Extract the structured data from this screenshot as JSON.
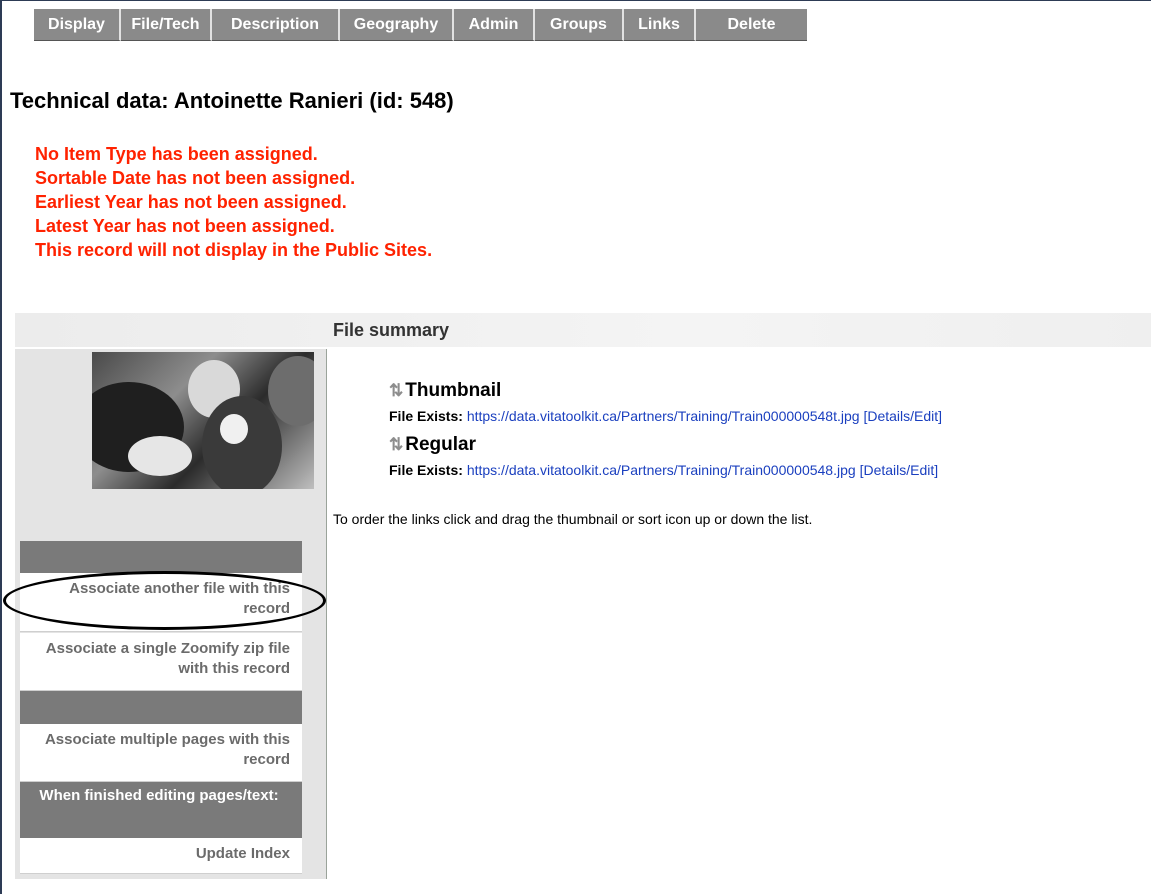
{
  "tabs": [
    "Display",
    "File/Tech",
    "Description",
    "Geography",
    "Admin",
    "Groups",
    "Links",
    "Delete"
  ],
  "page_title": "Technical data: Antoinette Ranieri (id: 548)",
  "warnings": [
    "No Item Type has been assigned.",
    "Sortable Date has not been assigned.",
    "Earliest Year has not been assigned.",
    "Latest Year has not been assigned.",
    "This record will not display in the Public Sites."
  ],
  "file_summary": {
    "title": "File summary",
    "files": [
      {
        "name": "Thumbnail",
        "label": "File Exists:",
        "url": "https://data.vitatoolkit.ca/Partners/Training/Train000000548t.jpg",
        "action": "[Details/Edit]"
      },
      {
        "name": "Regular",
        "label": "File Exists:",
        "url": "https://data.vitatoolkit.ca/Partners/Training/Train000000548.jpg",
        "action": "[Details/Edit]"
      }
    ],
    "instruction": "To order the links click and drag the thumbnail or sort icon up or down the list."
  },
  "sidebar": {
    "associate_file": "Associate another file with this record",
    "associate_zoomify": "Associate a single Zoomify zip file with this record",
    "associate_pages": "Associate multiple pages with this record",
    "finished_heading": "When finished editing pages/text:",
    "update_index": "Update Index"
  },
  "icons": {
    "sort": "sort-arrows-icon"
  },
  "colors": {
    "tab_bg": "#8a8a8a",
    "warning": "#ff2200",
    "link": "#1a3fbf"
  }
}
